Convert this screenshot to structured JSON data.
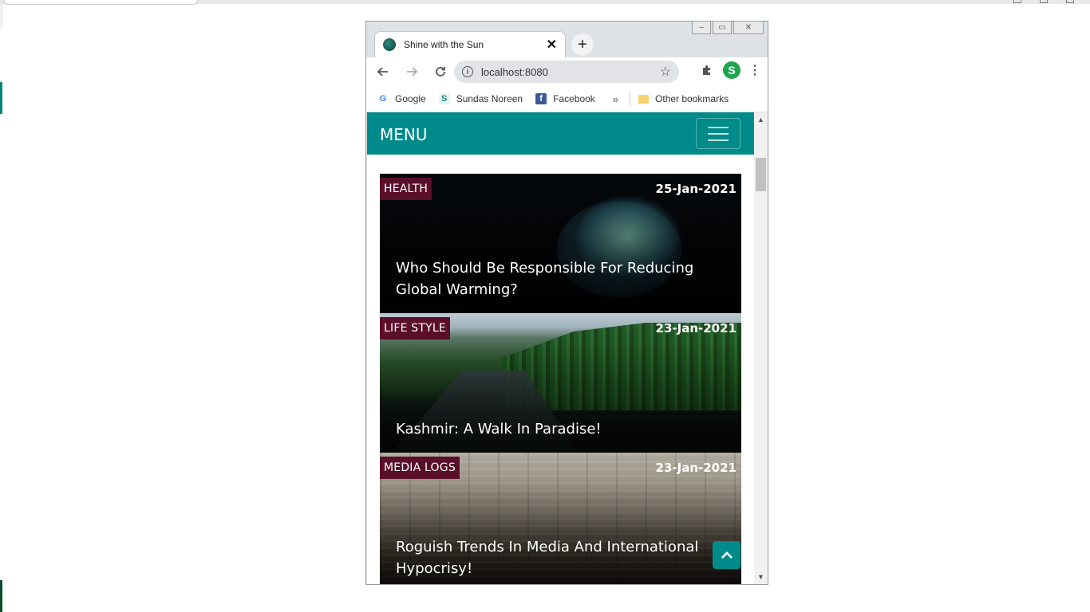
{
  "browser": {
    "tab_title": "Shine with the Sun",
    "tab_close": "✕",
    "new_tab": "+",
    "url": "localhost:8080",
    "profile_initial": "S",
    "window_controls": {
      "minimize": "–",
      "restore": "▭",
      "close": "✕"
    }
  },
  "bookmarks": [
    {
      "label": "Google",
      "icon": "G"
    },
    {
      "label": "Sundas Noreen",
      "icon": "S"
    },
    {
      "label": "Facebook",
      "icon": "f"
    }
  ],
  "bookmarks_more": "»",
  "other_bookmarks": "Other bookmarks",
  "navbar": {
    "brand": "MENU"
  },
  "posts": [
    {
      "category": "HEALTH",
      "date": "25-Jan-2021",
      "title": "Who Should Be Responsible For Reducing Global Warming?"
    },
    {
      "category": "LIFE STYLE",
      "date": "23-Jan-2021",
      "title": "Kashmir: A Walk In Paradise!"
    },
    {
      "category": "MEDIA LOGS",
      "date": "23-Jan-2021",
      "title": "Roguish Trends In Media And International Hypocrisy!"
    }
  ],
  "colors": {
    "navbar": "#008b8b",
    "category_badge": "#5a0e2a"
  },
  "icons": {
    "back": "arrow-left-icon",
    "forward": "arrow-right-icon",
    "reload": "reload-icon",
    "info": "info-icon",
    "star": "star-icon",
    "extensions": "puzzle-icon",
    "menu": "kebab-icon",
    "hamburger": "hamburger-icon",
    "back_to_top": "chevron-up-icon"
  }
}
